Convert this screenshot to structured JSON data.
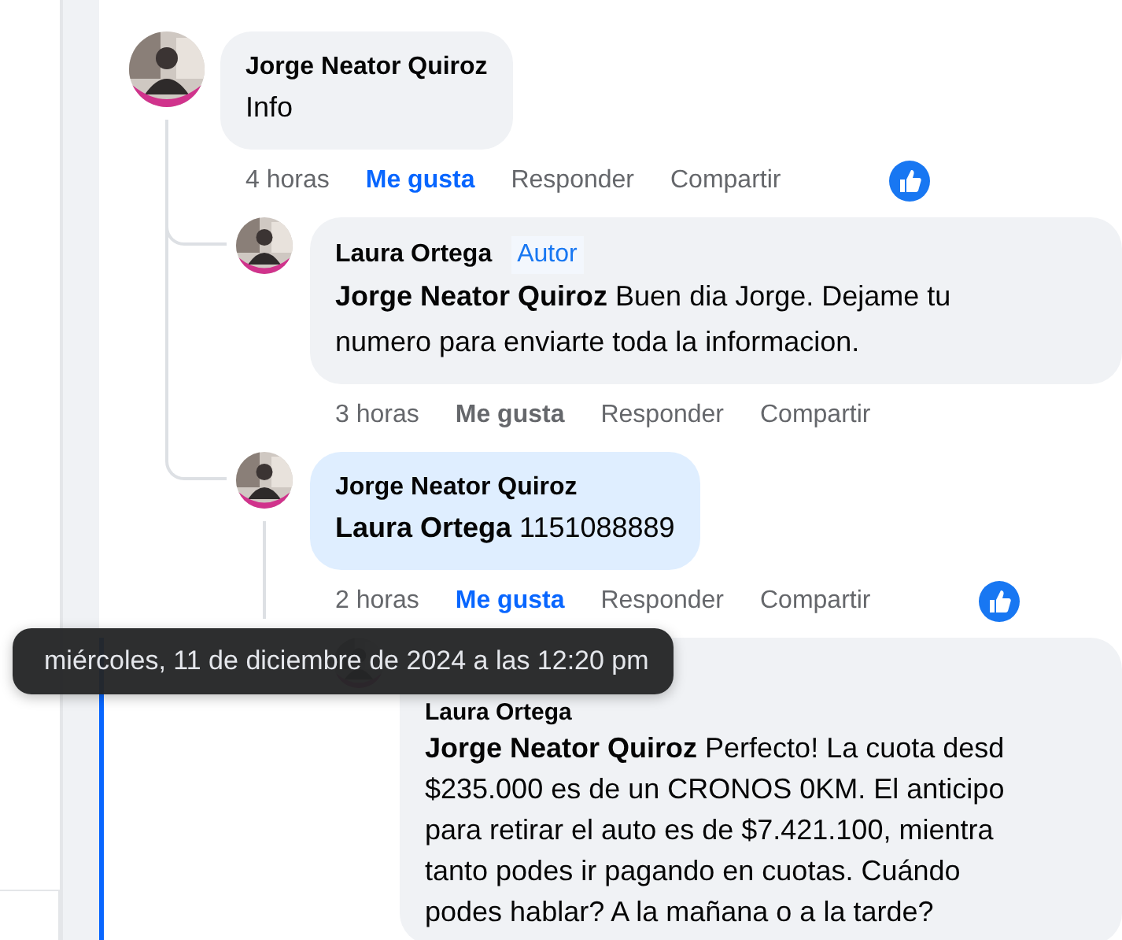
{
  "comments": [
    {
      "author": "Jorge Neator Quiroz",
      "highlighted": false,
      "lines": [
        "Info"
      ],
      "time": "4 horas",
      "actions": [
        "Me gusta",
        "Responder",
        "Compartir"
      ],
      "liked": true,
      "children": [
        {
          "author": "Laura Ortega",
          "badge": "Autor",
          "highlighted": false,
          "lines": [
            "**Jorge Neator Quiroz** Buen dia Jorge. Dejame tu",
            "numero para enviarte toda la informacion."
          ],
          "time": "3 horas",
          "actions": [
            "Me gusta",
            "Responder",
            "Compartir"
          ],
          "liked": false
        },
        {
          "author": "Jorge Neator Quiroz",
          "highlighted": true,
          "lines": [
            "**Laura Ortega** 1151088889"
          ],
          "time": "2 horas",
          "actions": [
            "Me gusta",
            "Responder",
            "Compartir"
          ],
          "liked": true,
          "children": [
            {
              "author": "Laura Ortega",
              "highlighted": false,
              "lines": [
                "**Jorge Neator Quiroz** Perfecto! La cuota desd",
                "$235.000 es de un CRONOS 0KM. El anticipo",
                "para retirar el auto es de $7.421.100, mientra",
                "tanto podes ir pagando en cuotas. Cuándo",
                "podes hablar? A la mañana o a la tarde?"
              ]
            }
          ]
        }
      ]
    }
  ],
  "tooltip": "miércoles, 11 de diciembre de 2024 a las 12:20 pm"
}
